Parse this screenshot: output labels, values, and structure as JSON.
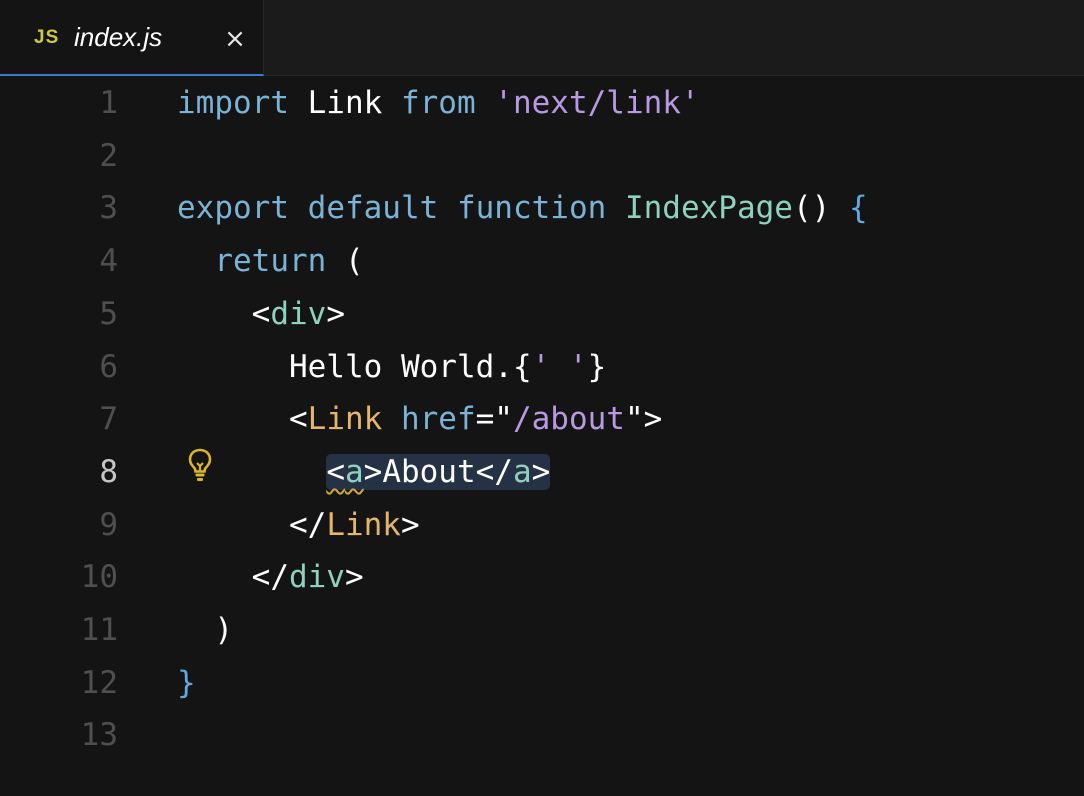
{
  "tab": {
    "icon_text": "JS",
    "title": "index.js",
    "close_glyph": "×"
  },
  "colors": {
    "background": "#141414",
    "keyword": "#7ab3d6",
    "function_name": "#8fd1bf",
    "string": "#b79ae2",
    "component": "#e4b56b",
    "lightbulb": "#d9b62b",
    "active_tab_border": "#3b79c9"
  },
  "icons": {
    "lightbulb": "lightbulb-icon",
    "close": "close-icon",
    "js_file": "js-file-icon"
  },
  "active_line": 8,
  "lines": [
    {
      "num": "1",
      "segs": [
        [
          "kw",
          "import"
        ],
        [
          "punc",
          " Link "
        ],
        [
          "kw",
          "from"
        ],
        [
          "punc",
          " "
        ],
        [
          "str",
          "'next/link'"
        ]
      ]
    },
    {
      "num": "2",
      "segs": []
    },
    {
      "num": "3",
      "segs": [
        [
          "kw",
          "export"
        ],
        [
          "punc",
          " "
        ],
        [
          "kw",
          "default"
        ],
        [
          "punc",
          " "
        ],
        [
          "kw",
          "function"
        ],
        [
          "punc",
          " "
        ],
        [
          "fn",
          "IndexPage"
        ],
        [
          "punc",
          "() "
        ],
        [
          "brace",
          "{"
        ]
      ]
    },
    {
      "num": "4",
      "segs": [
        [
          "punc",
          "  "
        ],
        [
          "kw",
          "return"
        ],
        [
          "punc",
          " ("
        ]
      ]
    },
    {
      "num": "5",
      "segs": [
        [
          "punc",
          "    <"
        ],
        [
          "tagc",
          "div"
        ],
        [
          "punc",
          ">"
        ]
      ]
    },
    {
      "num": "6",
      "segs": [
        [
          "punc",
          "      Hello World.{"
        ],
        [
          "str",
          "' '"
        ],
        [
          "punc",
          "}"
        ]
      ]
    },
    {
      "num": "7",
      "segs": [
        [
          "punc",
          "      <"
        ],
        [
          "comp",
          "Link"
        ],
        [
          "punc",
          " "
        ],
        [
          "attr",
          "href"
        ],
        [
          "punc",
          "=\""
        ],
        [
          "str",
          "/about"
        ],
        [
          "punc",
          "\">"
        ]
      ]
    },
    {
      "num": "8",
      "segs": [
        [
          "punc",
          "        "
        ],
        [
          "sel-start",
          ""
        ],
        [
          "squig",
          "<"
        ],
        [
          "squig-tag",
          "a"
        ],
        [
          "punc",
          ">About</"
        ],
        [
          "tagc",
          "a"
        ],
        [
          "punc",
          ">"
        ],
        [
          "sel-end",
          ""
        ]
      ]
    },
    {
      "num": "9",
      "segs": [
        [
          "punc",
          "      </"
        ],
        [
          "comp",
          "Link"
        ],
        [
          "punc",
          ">"
        ]
      ]
    },
    {
      "num": "10",
      "segs": [
        [
          "punc",
          "    </"
        ],
        [
          "tagc",
          "div"
        ],
        [
          "punc",
          ">"
        ]
      ]
    },
    {
      "num": "11",
      "segs": [
        [
          "punc",
          "  )"
        ]
      ]
    },
    {
      "num": "12",
      "segs": [
        [
          "brace",
          "}"
        ]
      ]
    },
    {
      "num": "13",
      "segs": []
    }
  ]
}
